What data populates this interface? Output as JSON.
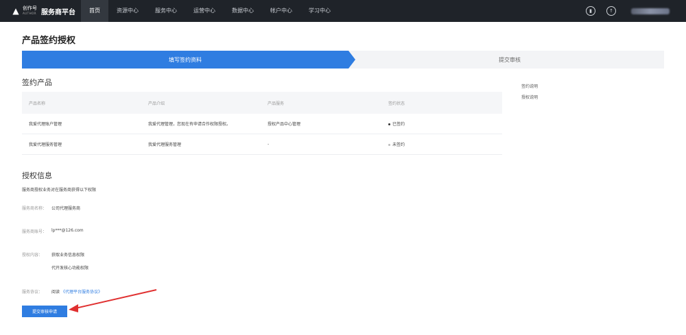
{
  "header": {
    "brand_line1": "创作号",
    "brand_line2": "AUTHOR",
    "platform_title": "服务商平台",
    "nav": [
      {
        "label": "首页",
        "active": true
      },
      {
        "label": "资源中心"
      },
      {
        "label": "服务中心"
      },
      {
        "label": "运营中心"
      },
      {
        "label": "数据中心"
      },
      {
        "label": "帐户中心"
      },
      {
        "label": "学习中心"
      }
    ]
  },
  "page": {
    "title": "产品签约授权",
    "steps": {
      "active": "填写签约资料",
      "next": "提交审核"
    }
  },
  "products": {
    "section_title": "签约产品",
    "columns": [
      "产品名称",
      "产品介绍",
      "产品服务",
      "签约状态"
    ],
    "rows": [
      {
        "name": "我爱代理账户管理",
        "intro": "我爱代理管理，您现在有申请合作权限授权。",
        "service": "授权产品中心管理",
        "status": "已签约"
      },
      {
        "name": "我爱代理服务管理",
        "intro": "我爱代理服务管理",
        "service": "-",
        "status": "未签约"
      }
    ]
  },
  "side_links": [
    "签约说明",
    "授权说明"
  ],
  "auth": {
    "section_title": "授权信息",
    "description": "服务商授权业务对在服务商获得以下权限",
    "fields": [
      {
        "label": "服务商名称：",
        "value": "公司代理服务商"
      },
      {
        "label": "服务商账号：",
        "value": "lp***@126.com"
      },
      {
        "label": "授权内容：",
        "value": "获取业务信息权限",
        "value2": "代开发核心功能权限"
      },
      {
        "label": "服务协议：",
        "value": "阅读",
        "link": "《代理平台服务协议》"
      }
    ],
    "submit_label": "提交审核申请"
  },
  "colors": {
    "accent": "#2f7de1",
    "topbar": "#1f2329",
    "annotation_arrow": "#e03030"
  }
}
